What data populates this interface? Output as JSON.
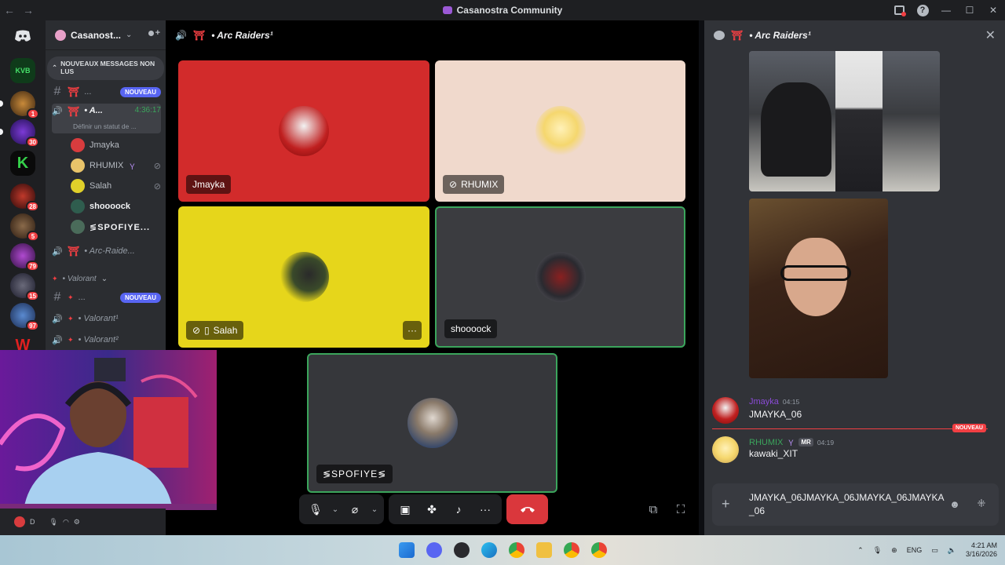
{
  "window": {
    "title": "Casanostra Community"
  },
  "server": {
    "name": "Casanost...",
    "new_messages_banner": "NOUVEAUX MESSAGES NON LUS"
  },
  "server_rail": {
    "home_label": "Discord",
    "servers": [
      {
        "name": "KVB",
        "badge": ""
      },
      {
        "name": "server-2",
        "badge": "1"
      },
      {
        "name": "server-3",
        "badge": "30"
      },
      {
        "name": "server-4",
        "badge": ""
      },
      {
        "name": "server-5",
        "badge": "28"
      },
      {
        "name": "server-6",
        "badge": "5"
      },
      {
        "name": "server-7",
        "badge": "79"
      },
      {
        "name": "server-8",
        "badge": "15"
      },
      {
        "name": "server-9",
        "badge": "97"
      }
    ]
  },
  "channels": {
    "row1": {
      "name": "...",
      "badge": "NOUVEAU"
    },
    "active_voice": {
      "name": "• A...",
      "timer": "4:36:17",
      "status": "Définir un statut de ..."
    },
    "voice_users": [
      {
        "name": "Jmayka",
        "color": "#d83c3e"
      },
      {
        "name": "RHUMIX",
        "color": "#e9c46a"
      },
      {
        "name": "Salah",
        "color": "#e0d02a"
      },
      {
        "name": "shoooock",
        "color": "#2f5d4e"
      },
      {
        "name": "≶SPOFIYE...",
        "color": "#4a6b5a"
      }
    ],
    "arc_raiders": "• Arc-Raide...",
    "category": "• Valorant",
    "valorant_text": {
      "name": "...",
      "badge": "NOUVEAU"
    },
    "valorant_voice_1": "• Valorant¹",
    "valorant_voice_2": "• Valorant²"
  },
  "call": {
    "channel_title": "• Arc Raiders¹",
    "tiles": [
      {
        "name": "Jmayka",
        "bg": "#d22b2b"
      },
      {
        "name": "RHUMIX",
        "bg": "#f0d9cc"
      },
      {
        "name": "Salah",
        "bg": "#e6d61b"
      },
      {
        "name": "shoooock",
        "bg": "#3b3c40"
      },
      {
        "name": "≶SPOFIYE≶",
        "bg": "#36373b"
      }
    ],
    "more_label": "···",
    "hangup_label": "Leave call"
  },
  "chat": {
    "title": "• Arc Raiders¹",
    "messages": [
      {
        "author": "Jmayka",
        "author_color": "#8a4bd6",
        "time": "04:15",
        "text": "JMAYKA_06"
      },
      {
        "author": "RHUMIX",
        "author_color": "#3ba55c",
        "tag": "MR",
        "time": "04:19",
        "text": "kawaki_XIT"
      }
    ],
    "new_divider": "NOUVEAU",
    "composer_text": "JMAYKA_06JMAYKA_06JMAYKA_06JMAYKA_06"
  },
  "user_bar": {
    "status_text": "D"
  },
  "taskbar": {
    "lang": "ENG",
    "time": "4:21 AM",
    "date": "3/16/2026"
  }
}
